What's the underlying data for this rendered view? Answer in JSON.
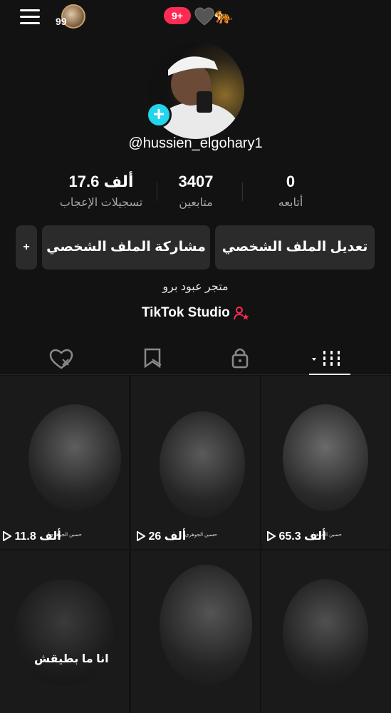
{
  "topbar": {
    "avatar_count": "99",
    "notifications": "9+"
  },
  "profile": {
    "username": "@hussien_elgohary1",
    "bio": "متجر عبود برو",
    "studio_label": "TikTok Studio"
  },
  "stats": [
    {
      "value": "0",
      "label": "أتابعه"
    },
    {
      "value": "3407",
      "label": "متابعين"
    },
    {
      "value": "17.6 ألف",
      "label": "تسجيلات الإعجاب"
    }
  ],
  "buttons": {
    "edit": "تعديل الملف الشخصي",
    "share": "مشاركة الملف الشخصي",
    "add_friend": "+"
  },
  "tabs": [
    "videos",
    "private",
    "reposts",
    "liked"
  ],
  "videos": [
    {
      "views": "65.3 ألف",
      "credit": "حسين الجوهري",
      "caption": ""
    },
    {
      "views": "26 ألف",
      "credit": "حسين الجوهري",
      "caption": ""
    },
    {
      "views": "11.8 ألف",
      "credit": "حسين الجوهري",
      "caption": ""
    },
    {
      "views": "",
      "credit": "",
      "caption": ""
    },
    {
      "views": "",
      "credit": "",
      "caption": ""
    },
    {
      "views": "",
      "credit": "",
      "caption": "انا ما بطيقش"
    }
  ]
}
